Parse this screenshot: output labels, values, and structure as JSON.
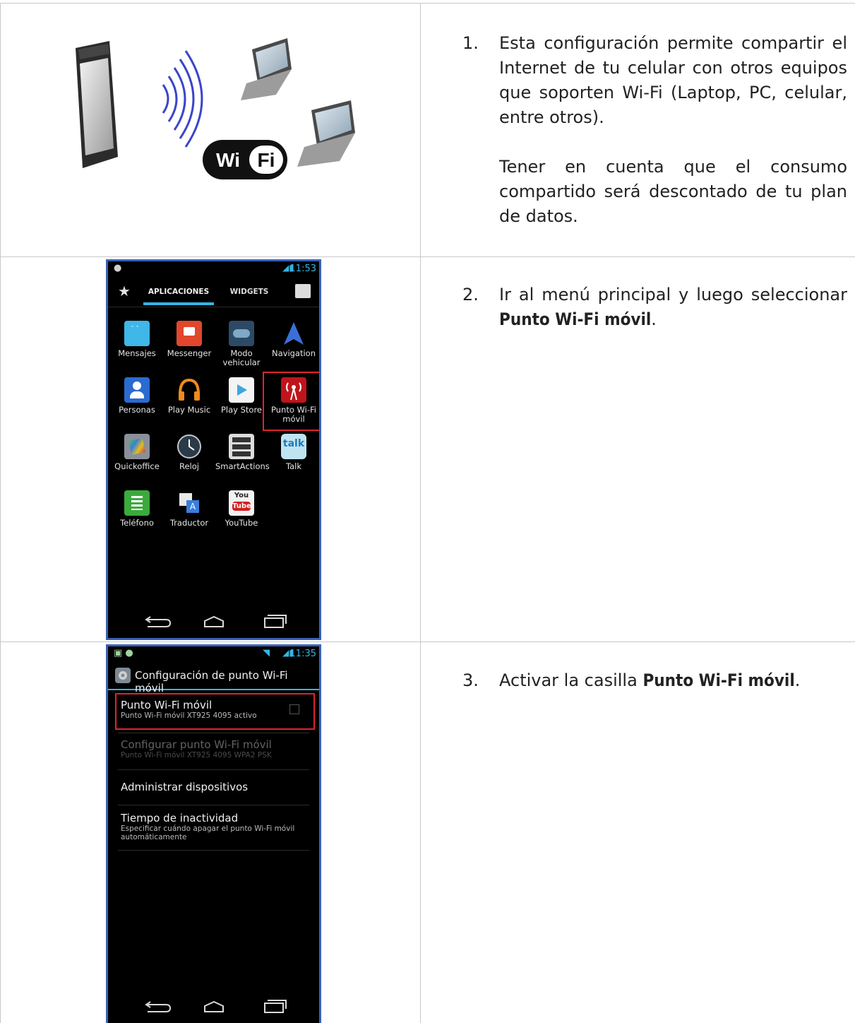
{
  "steps": [
    {
      "num": "1.",
      "text": "Esta configuración permite compartir el Internet de tu celular con otros equipos que soporten Wi-Fi (Laptop, PC, celular, entre otros).",
      "note": "Tener en cuenta que el consumo compartido será descontado de tu plan de datos."
    },
    {
      "num": "2.",
      "text_prefix": "Ir al menú principal y luego seleccionar ",
      "bold": "Punto Wi-Fi móvil",
      "text_suffix": "."
    },
    {
      "num": "3.",
      "text_prefix": "Activar la casilla ",
      "bold": "Punto Wi-Fi móvil",
      "text_suffix": "."
    }
  ],
  "illustration": {
    "wifi_logo_left": "Wi",
    "wifi_logo_right": "Fi"
  },
  "app_drawer": {
    "time": "11:53",
    "tabs": [
      "APLICACIONES",
      "WIDGETS"
    ],
    "apps": [
      {
        "label": "Mensajes",
        "icon": "messages-icon"
      },
      {
        "label": "Messenger",
        "icon": "messenger-icon"
      },
      {
        "label": "Modo vehicular",
        "icon": "car-mode-icon"
      },
      {
        "label": "Navigation",
        "icon": "navigation-icon"
      },
      {
        "label": "Personas",
        "icon": "contacts-icon"
      },
      {
        "label": "Play Music",
        "icon": "headphones-icon"
      },
      {
        "label": "Play Store",
        "icon": "play-store-icon"
      },
      {
        "label": "Punto Wi-Fi móvil",
        "icon": "hotspot-icon"
      },
      {
        "label": "Quickoffice",
        "icon": "quickoffice-icon"
      },
      {
        "label": "Reloj",
        "icon": "clock-icon"
      },
      {
        "label": "SmartActions",
        "icon": "smartactions-icon"
      },
      {
        "label": "Talk",
        "icon": "talk-icon"
      },
      {
        "label": "Teléfono",
        "icon": "phone-icon"
      },
      {
        "label": "Traductor",
        "icon": "translate-icon"
      },
      {
        "label": "YouTube",
        "icon": "youtube-icon"
      }
    ],
    "talk_badge": "talk",
    "youtube_badge_top": "You",
    "youtube_badge_bottom": "Tube"
  },
  "hotspot_settings": {
    "time": "11:35",
    "header": "Configuración de punto Wi-Fi móvil",
    "items": [
      {
        "title": "Punto Wi-Fi móvil",
        "subtitle": "Punto Wi-Fi móvil XT925 4095 activo"
      },
      {
        "title": "Configurar punto Wi-Fi móvil",
        "subtitle": "Punto Wi-Fi móvil XT925 4095 WPA2 PSK"
      },
      {
        "title": "Administrar dispositivos",
        "subtitle": ""
      },
      {
        "title": "Tiempo de inactividad",
        "subtitle": "Especificar cuándo apagar el punto Wi-Fi móvil automáticamente"
      }
    ],
    "checkbox_checked": false
  },
  "colors": {
    "accent_blue": "#33b5e5",
    "highlight_red": "#e0242b",
    "frame_blue": "#3a62b8"
  }
}
